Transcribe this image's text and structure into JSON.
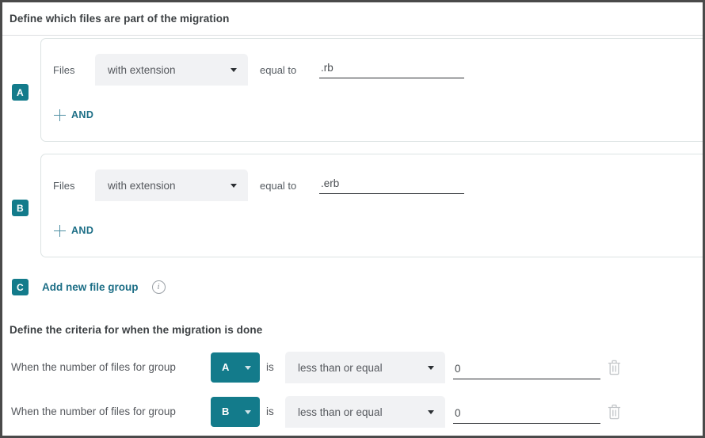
{
  "sections": {
    "files": {
      "title": "Define which files are part of the migration",
      "add_group": {
        "badge": "C",
        "label": "Add new file group",
        "info_icon": "info-icon",
        "info_glyph": "i"
      },
      "groups": [
        {
          "badge": "A",
          "row_label": "Files",
          "condition": "with extension",
          "operator_label": "equal to",
          "value": ".rb",
          "value_placeholder": "",
          "and_label": "AND"
        },
        {
          "badge": "B",
          "row_label": "Files",
          "condition": "with extension",
          "operator_label": "equal to",
          "value": ".erb",
          "value_placeholder": "",
          "and_label": "AND"
        }
      ]
    },
    "criteria": {
      "title": "Define the criteria for when the migration is done",
      "rows": [
        {
          "prefix": "When the number of files for group",
          "group": "A",
          "is_label": "is",
          "operator": "less than or equal",
          "value": "0",
          "delete_icon": "trash-icon"
        },
        {
          "prefix": "When the number of files for group",
          "group": "B",
          "is_label": "is",
          "operator": "less than or equal",
          "value": "0",
          "delete_icon": "trash-icon"
        }
      ]
    }
  },
  "colors": {
    "accent_teal": "#137b8b",
    "link_teal": "#1c6e86",
    "select_grey": "#f1f2f4",
    "text_dark": "#3c4043",
    "text_muted": "#56595e",
    "card_border": "#dce3e3"
  }
}
